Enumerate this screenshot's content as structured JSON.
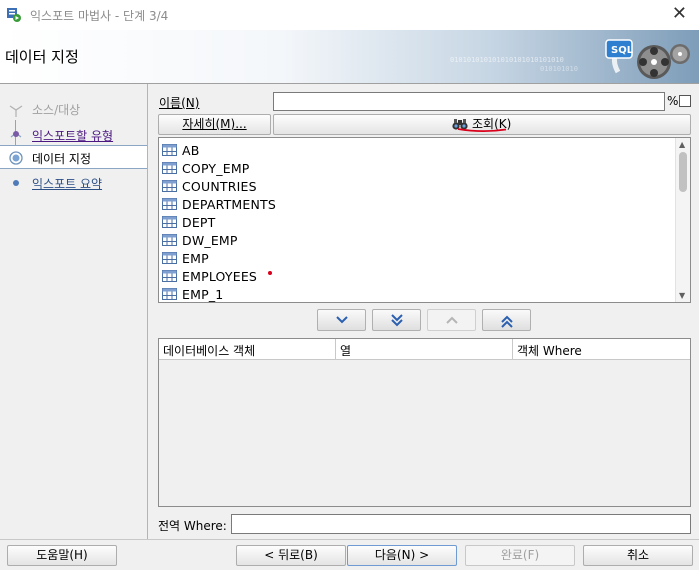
{
  "window": {
    "title": "익스포트 마법사 - 단계 3/4",
    "close_glyph": "✕"
  },
  "banner": {
    "heading": "데이터 지정",
    "binary_1": "010101010101010101010101010",
    "binary_2": "010101010",
    "art_text": "SQL"
  },
  "steps": [
    {
      "label": "소스/대상",
      "state": "done"
    },
    {
      "label": "익스포트할 유형",
      "state": "link"
    },
    {
      "label": "데이터 지정",
      "state": "active"
    },
    {
      "label": "익스포트 요약",
      "state": "link"
    }
  ],
  "filter": {
    "name_label": "이름(N)",
    "name_value": "",
    "percent": "%",
    "percent_checked": false,
    "details_button": "자세히(M)...",
    "query_button": "조회(K)"
  },
  "objects": [
    "AB",
    "COPY_EMP",
    "COUNTRIES",
    "DEPARTMENTS",
    "DEPT",
    "DW_EMP",
    "EMP",
    "EMPLOYEES",
    "EMP_1"
  ],
  "move_buttons": [
    {
      "name": "move-down-button",
      "icon": "chevron-down-icon",
      "enabled": true
    },
    {
      "name": "move-all-down-button",
      "icon": "double-chevron-down-icon",
      "enabled": true
    },
    {
      "name": "move-up-button",
      "icon": "chevron-up-icon",
      "enabled": false
    },
    {
      "name": "move-all-up-button",
      "icon": "double-chevron-up-icon",
      "enabled": true
    }
  ],
  "grid": {
    "columns": [
      "데이터베이스 객체",
      "열",
      "객체 Where"
    ]
  },
  "global_where": {
    "label": "전역 Where:",
    "value": ""
  },
  "footer": {
    "help": "도움말(H)",
    "back": "< 뒤로(B)",
    "next": "다음(N) >",
    "finish": "완료(F)",
    "cancel": "취소"
  },
  "colors": {
    "accent_underline": "#d9001b",
    "link": "#4b1882"
  }
}
